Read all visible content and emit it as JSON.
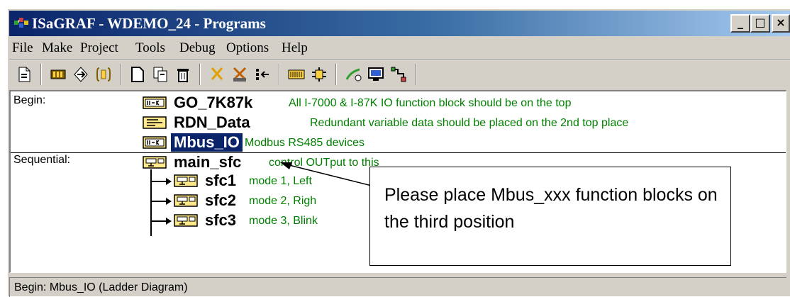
{
  "window": {
    "title": "ISaGRAF - WDEMO_24 - Programs",
    "buttons": {
      "minimize": "_",
      "maximize": "□",
      "close": "×"
    }
  },
  "menu": [
    {
      "label": "File"
    },
    {
      "label": "Make"
    },
    {
      "label": "Project"
    },
    {
      "label": "Tools"
    },
    {
      "label": "Debug"
    },
    {
      "label": "Options"
    },
    {
      "label": "Help"
    }
  ],
  "toolbar": {
    "icons": [
      "document-icon",
      "library-icon",
      "compile-icon",
      "variables-icon",
      "new-program-icon",
      "copy-icon",
      "delete-icon",
      "cut-icon",
      "dictionary-icon",
      "move-icon",
      "io-connection-icon",
      "debug-icon",
      "simulate-icon",
      "monitor-icon",
      "link-icon"
    ]
  },
  "sections": {
    "begin": {
      "label": "Begin:",
      "programs": [
        {
          "name": "GO_7K87k",
          "icon": "function-block-icon",
          "description": "All I-7000 & I-87K IO function block should be on the top"
        },
        {
          "name": "RDN_Data",
          "icon": "structured-text-icon",
          "description": "Redundant variable data should be placed on the 2nd top place"
        },
        {
          "name": "Mbus_IO",
          "icon": "function-block-icon",
          "description": "Modbus RS485 devices",
          "selected": true
        }
      ]
    },
    "sequential": {
      "label": "Sequential:",
      "main": {
        "name": "main_sfc",
        "icon": "sfc-icon",
        "description": "control OUTput to this"
      },
      "children": [
        {
          "name": "sfc1",
          "icon": "sfc-icon",
          "description": "mode 1, Left"
        },
        {
          "name": "sfc2",
          "icon": "sfc-icon",
          "description": "mode 2, Righ"
        },
        {
          "name": "sfc3",
          "icon": "sfc-icon",
          "description": "mode 3, Blink"
        }
      ]
    }
  },
  "callout": {
    "text": "Please place Mbus_xxx function blocks on the third position"
  },
  "status": {
    "text": "Begin:  Mbus_IO  (Ladder Diagram)"
  }
}
